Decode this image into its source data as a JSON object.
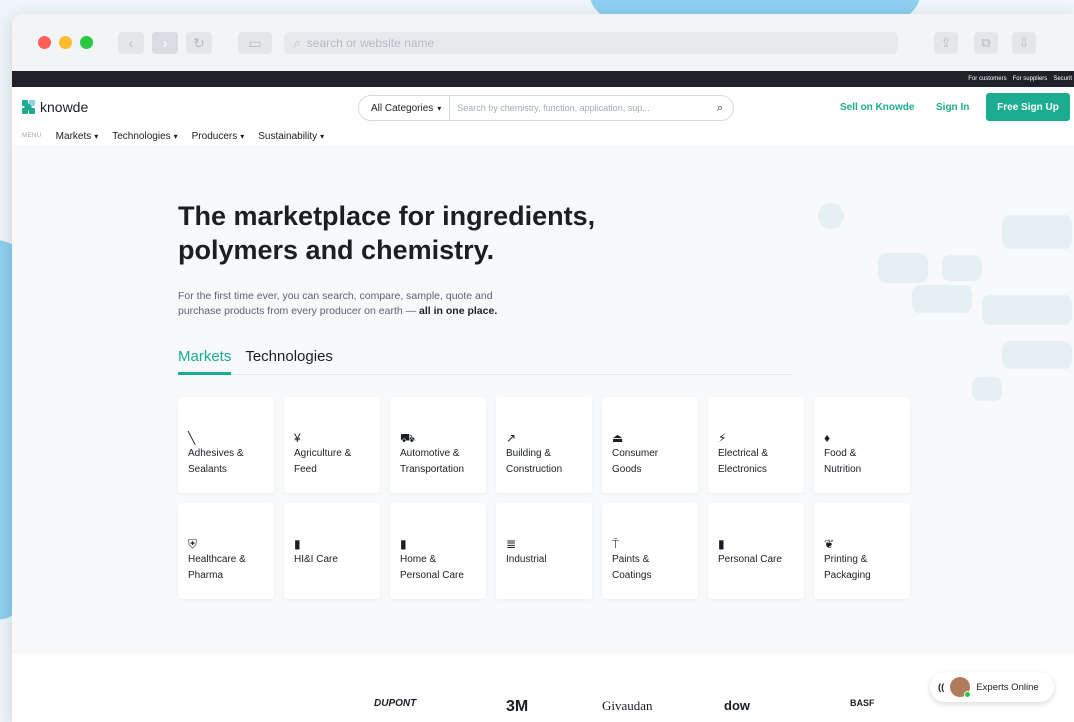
{
  "browser": {
    "address_placeholder": "search or website name"
  },
  "topstrip": {
    "links": [
      "For customers",
      "For suppliers",
      "Securit"
    ]
  },
  "header": {
    "logo_text": "knowde",
    "category_select": "All Categories",
    "search_placeholder": "Search by chemistry, function, application, sup...",
    "sell_link": "Sell on Knowde",
    "signin_link": "Sign In",
    "signup_button": "Free Sign Up"
  },
  "menu": {
    "label": "MENU",
    "items": [
      "Markets",
      "Technologies",
      "Producers",
      "Sustainability"
    ]
  },
  "hero": {
    "title_line1": "The marketplace for ingredients,",
    "title_line2": "polymers and chemistry.",
    "sub_line1": "For the first time ever, you can search, compare, sample, quote and",
    "sub_line2": "purchase products from every producer on earth —",
    "sub_bold": "all in one place."
  },
  "tabs": [
    "Markets",
    "Technologies"
  ],
  "markets": [
    {
      "line1": "Adhesives &",
      "line2": "Sealants",
      "icon": "adhesive-icon",
      "glyph": "╲"
    },
    {
      "line1": "Agriculture &",
      "line2": "Feed",
      "icon": "wheat-icon",
      "glyph": "¥"
    },
    {
      "line1": "Automotive &",
      "line2": "Transportation",
      "icon": "car-icon",
      "glyph": "⛟"
    },
    {
      "line1": "Building &",
      "line2": "Construction",
      "icon": "hammer-icon",
      "glyph": "↗"
    },
    {
      "line1": "Consumer",
      "line2": "Goods",
      "icon": "hanger-icon",
      "glyph": "⏏"
    },
    {
      "line1": "Electrical &",
      "line2": "Electronics",
      "icon": "lightning-icon",
      "glyph": "⚡"
    },
    {
      "line1": "Food &",
      "line2": "Nutrition",
      "icon": "carrot-icon",
      "glyph": "♦"
    },
    {
      "line1": "Healthcare &",
      "line2": "Pharma",
      "icon": "shield-icon",
      "glyph": "⛨"
    },
    {
      "line1": "HI&I Care",
      "line2": "",
      "icon": "spray-bottle-icon",
      "glyph": "▮"
    },
    {
      "line1": "Home &",
      "line2": "Personal Care",
      "icon": "bottle-icon",
      "glyph": "▮"
    },
    {
      "line1": "Industrial",
      "line2": "",
      "icon": "barrel-icon",
      "glyph": "≣"
    },
    {
      "line1": "Paints &",
      "line2": "Coatings",
      "icon": "paint-roller-icon",
      "glyph": "⍑"
    },
    {
      "line1": "Personal Care",
      "line2": "",
      "icon": "lotion-icon",
      "glyph": "▮"
    },
    {
      "line1": "Printing &",
      "line2": "Packaging",
      "icon": "box-icon",
      "glyph": "❦"
    }
  ],
  "brands": [
    "DUPONT",
    "3M",
    "Givaudan",
    "dow",
    "BASF"
  ],
  "experts": {
    "label": "Experts Online"
  },
  "colors": {
    "accent": "#1cac8f",
    "dark": "#1b1f24",
    "topstrip": "#1e2228"
  }
}
